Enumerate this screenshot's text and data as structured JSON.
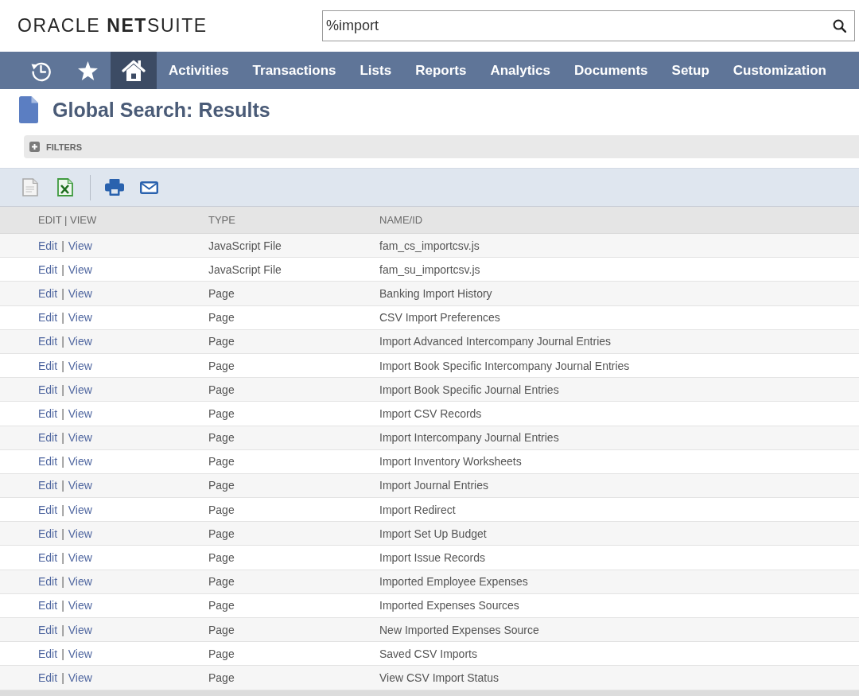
{
  "header": {
    "logo": "ORACLE **NET**SUITE",
    "search": {
      "value": "%import"
    }
  },
  "nav": {
    "items": [
      {
        "kind": "history",
        "selected": false
      },
      {
        "kind": "favorites",
        "selected": false
      },
      {
        "kind": "home",
        "selected": true
      },
      {
        "kind": "menu",
        "label": "Activities",
        "selected": false
      },
      {
        "kind": "menu",
        "label": "Transactions",
        "selected": false
      },
      {
        "kind": "menu",
        "label": "Lists",
        "selected": false
      },
      {
        "kind": "menu",
        "label": "Reports",
        "selected": false
      },
      {
        "kind": "menu",
        "label": "Analytics",
        "selected": false
      },
      {
        "kind": "menu",
        "label": "Documents",
        "selected": false
      },
      {
        "kind": "menu",
        "label": "Setup",
        "selected": false
      },
      {
        "kind": "menu",
        "label": "Customization",
        "selected": false
      }
    ]
  },
  "page": {
    "title": "Global Search: Results"
  },
  "filters": {
    "label": "FILTERS",
    "expanded": false
  },
  "toolbar": {
    "items": [
      {
        "kind": "document"
      },
      {
        "kind": "spreadsheet"
      },
      {
        "kind": "separator"
      },
      {
        "kind": "print"
      },
      {
        "kind": "email"
      }
    ]
  },
  "table": {
    "columns": [
      "EDIT | VIEW",
      "TYPE",
      "NAME/ID"
    ],
    "rows": [
      {
        "edit": "Edit",
        "separator": "|",
        "view": "View",
        "type": "JavaScript File",
        "name": "fam_cs_importcsv.js"
      },
      {
        "edit": "Edit",
        "separator": "|",
        "view": "View",
        "type": "JavaScript File",
        "name": "fam_su_importcsv.js"
      },
      {
        "edit": "Edit",
        "separator": "|",
        "view": "View",
        "type": "Page",
        "name": "Banking Import History"
      },
      {
        "edit": "Edit",
        "separator": "|",
        "view": "View",
        "type": "Page",
        "name": "CSV Import Preferences"
      },
      {
        "edit": "Edit",
        "separator": "|",
        "view": "View",
        "type": "Page",
        "name": "Import Advanced Intercompany Journal Entries"
      },
      {
        "edit": "Edit",
        "separator": "|",
        "view": "View",
        "type": "Page",
        "name": "Import Book Specific Intercompany Journal Entries"
      },
      {
        "edit": "Edit",
        "separator": "|",
        "view": "View",
        "type": "Page",
        "name": "Import Book Specific Journal Entries"
      },
      {
        "edit": "Edit",
        "separator": "|",
        "view": "View",
        "type": "Page",
        "name": "Import CSV Records"
      },
      {
        "edit": "Edit",
        "separator": "|",
        "view": "View",
        "type": "Page",
        "name": "Import Intercompany Journal Entries"
      },
      {
        "edit": "Edit",
        "separator": "|",
        "view": "View",
        "type": "Page",
        "name": "Import Inventory Worksheets"
      },
      {
        "edit": "Edit",
        "separator": "|",
        "view": "View",
        "type": "Page",
        "name": "Import Journal Entries"
      },
      {
        "edit": "Edit",
        "separator": "|",
        "view": "View",
        "type": "Page",
        "name": "Import Redirect"
      },
      {
        "edit": "Edit",
        "separator": "|",
        "view": "View",
        "type": "Page",
        "name": "Import Set Up Budget"
      },
      {
        "edit": "Edit",
        "separator": "|",
        "view": "View",
        "type": "Page",
        "name": "Import Issue Records"
      },
      {
        "edit": "Edit",
        "separator": "|",
        "view": "View",
        "type": "Page",
        "name": "Imported Employee Expenses"
      },
      {
        "edit": "Edit",
        "separator": "|",
        "view": "View",
        "type": "Page",
        "name": "Imported Expenses Sources"
      },
      {
        "edit": "Edit",
        "separator": "|",
        "view": "View",
        "type": "Page",
        "name": "New Imported Expenses Source"
      },
      {
        "edit": "Edit",
        "separator": "|",
        "view": "View",
        "type": "Page",
        "name": "Saved CSV Imports"
      },
      {
        "edit": "Edit",
        "separator": "|",
        "view": "View",
        "type": "Page",
        "name": "View CSV Import Status"
      }
    ]
  }
}
